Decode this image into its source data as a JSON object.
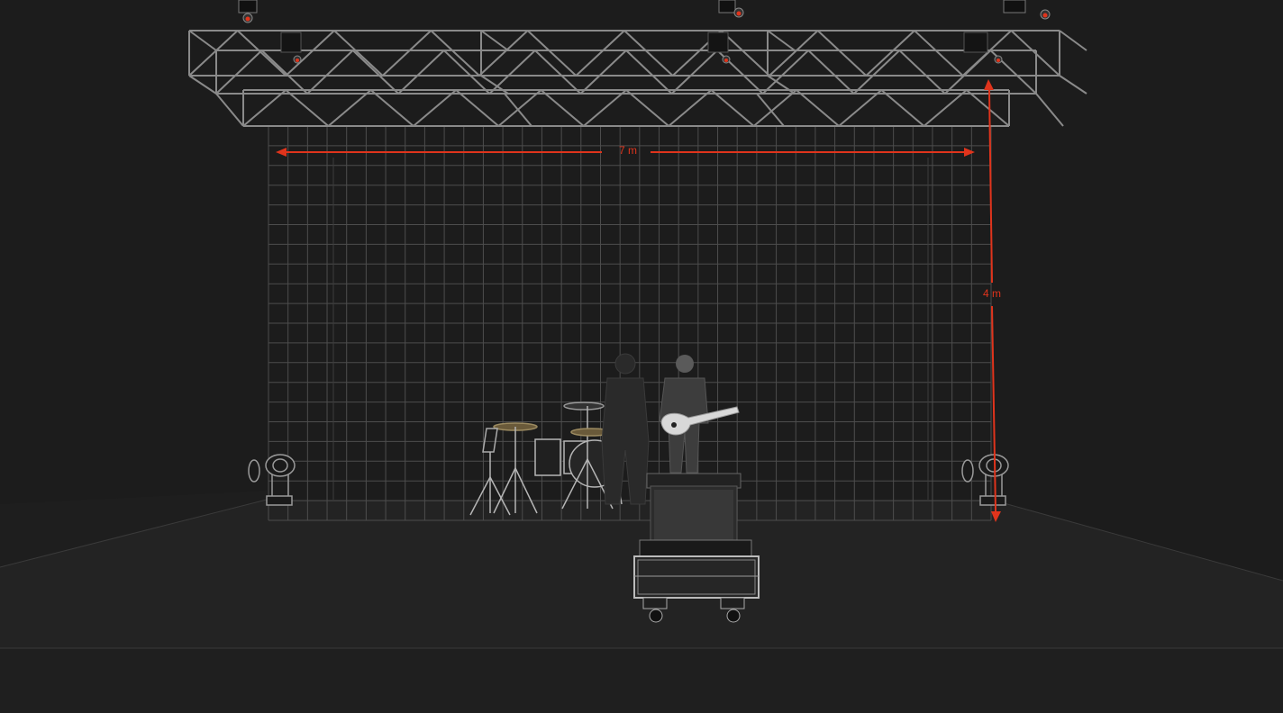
{
  "dimensions": {
    "width_label": "7 m",
    "height_label": "4 m"
  },
  "colors": {
    "background": "#1c1c1c",
    "floor": "#222222",
    "stage_front": "#1f1f1f",
    "grid_line": "#5a5a5a",
    "truss": "#8a8a8a",
    "dimension": "#e0341c"
  },
  "icons": {
    "moving_head_light": "moving-head-light-icon",
    "par_light": "hanging-spotlight-icon",
    "drum_kit": "drum-kit-icon",
    "guitarist": "guitarist-figure-icon",
    "drummer": "drummer-silhouette-icon",
    "flight_case": "flight-case-icon"
  }
}
